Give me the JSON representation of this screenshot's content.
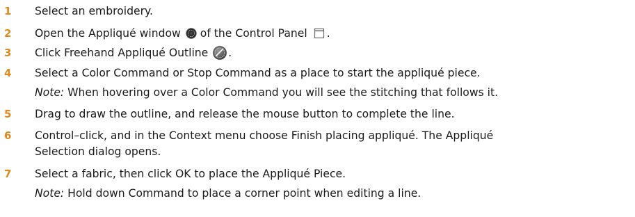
{
  "steps": [
    {
      "number": "1",
      "text": "Select an embroidery."
    },
    {
      "number": "2",
      "text_a": "Open the Appliqué window",
      "text_b": "of the Control Panel",
      "text_c": ".",
      "icon_a": "applique-window-icon",
      "icon_b": "control-panel-icon"
    },
    {
      "number": "3",
      "text_a": "Click Freehand Appliqué Outline",
      "text_b": ".",
      "icon": "freehand-applique-outline-icon"
    },
    {
      "number": "4",
      "text": "Select a Color Command or Stop Command as a place to start the appliqué piece."
    },
    {
      "note_label": "Note:",
      "note_text": " When hovering over a Color Command you will see the stitching that follows it."
    },
    {
      "number": "5",
      "text": "Drag to draw the outline, and release the mouse button to complete the line."
    },
    {
      "number": "6",
      "text_line1": "Control–click, and in the Context menu choose Finish placing appliqué. The Appliqué",
      "text_line2": "Selection dialog opens."
    },
    {
      "number": "7",
      "text": "Select a fabric, then click OK to place the Appliqué Piece."
    },
    {
      "note_label": "Note:",
      "note_text": " Hold down Command to place a corner point when editing a line."
    }
  ],
  "colors": {
    "step_number": "#e08a1e",
    "text": "#1a1a1a"
  }
}
